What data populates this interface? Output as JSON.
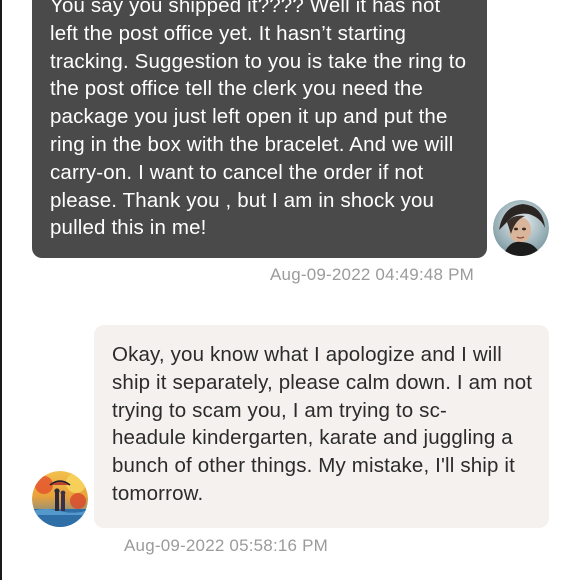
{
  "conversation": {
    "sent_message": {
      "text": "You say you shipped it???? Well it has not left the post office yet. It hasn’t starting tracking. Suggestion to you is take the ring to the post office tell the clerk you need the package you just left open it up and put the ring in the box with the bracelet. And we will carry-on. I want to cancel the order if not please. Thank you , but I am in shock you pulled this in me!",
      "timestamp": "Aug-09-2022 04:49:48 PM",
      "bubble_color": "#4a4a4a",
      "avatar_icon": "user-avatar-icon"
    },
    "received_message": {
      "text": "Okay, you know what I apologize and I will ship it separately, please calm down. I am not trying to scam you, I am trying to schedule kindergarten, karate and juggling a bunch of other things. My mistake, I'll ship it tomorrow.",
      "timestamp": "Aug-09-2022 05:58:16 PM",
      "bubble_color": "#f4f1ee",
      "avatar_icon": "painting-avatar-icon"
    }
  }
}
